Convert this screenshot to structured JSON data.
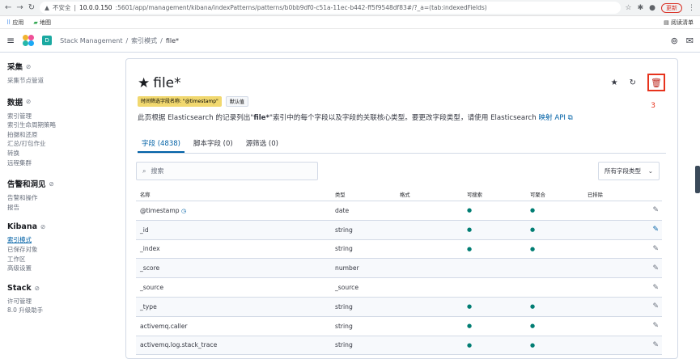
{
  "browser": {
    "security": "不安全",
    "url_host": "10.0.0.150",
    "url_rest": ":5601/app/management/kibana/indexPatterns/patterns/b0bb9df0-c51a-11ec-b442-ff5f9548df83#/?_a=(tab:indexedFields)",
    "update_label": "更新",
    "bookmarks": [
      "应用",
      "地图"
    ],
    "reading_list": "阅读清单"
  },
  "header": {
    "space_letter": "D",
    "breadcrumb": [
      "Stack Management",
      "索引模式",
      "file*"
    ]
  },
  "sidebar": {
    "sections": [
      {
        "title": "采集",
        "items": [
          "采集节点管道"
        ]
      },
      {
        "title": "数据",
        "items": [
          "索引管理",
          "索引生命周期策略",
          "拍摄和还原",
          "汇总/打包作业",
          "转换",
          "远程集群"
        ]
      },
      {
        "title": "告警和洞见",
        "items": [
          "告警和操作",
          "报告"
        ]
      },
      {
        "title": "Kibana",
        "items": [
          "索引模式",
          "已保存对象",
          "工作区",
          "高级设置"
        ]
      },
      {
        "title": "Stack",
        "items": [
          "许可管理",
          "8.0 升级助手"
        ]
      }
    ],
    "active_item": "索引模式"
  },
  "panel": {
    "title": "file*",
    "badge_time": "时间筛选字段名称: \"@timestamp\"",
    "badge_default": "默认值",
    "annotation": "3",
    "desc_pre": "此页根据 Elasticsearch 的记录列出\"",
    "desc_bold": "file*",
    "desc_mid": "\"索引中的每个字段以及字段的关联核心类型。要更改字段类型，请使用 Elasticsearch ",
    "desc_link": "映射 API",
    "tabs": [
      "字段 (4838)",
      "脚本字段 (0)",
      "源筛选 (0)"
    ],
    "search_placeholder": "搜索",
    "filter_label": "所有字段类型",
    "columns": {
      "name": "名称",
      "type": "类型",
      "format": "格式",
      "searchable": "可搜索",
      "aggregatable": "可聚合",
      "excluded": "已排除"
    },
    "rows": [
      {
        "name": "@timestamp",
        "type": "date",
        "searchable": true,
        "aggregatable": true,
        "clock": true
      },
      {
        "name": "_id",
        "type": "string",
        "searchable": true,
        "aggregatable": true,
        "blue_edit": true
      },
      {
        "name": "_index",
        "type": "string",
        "searchable": true,
        "aggregatable": true
      },
      {
        "name": "_score",
        "type": "number",
        "searchable": false,
        "aggregatable": false
      },
      {
        "name": "_source",
        "type": "_source",
        "searchable": false,
        "aggregatable": false
      },
      {
        "name": "_type",
        "type": "string",
        "searchable": true,
        "aggregatable": true
      },
      {
        "name": "activemq.caller",
        "type": "string",
        "searchable": true,
        "aggregatable": true
      },
      {
        "name": "activemq.log.stack_trace",
        "type": "string",
        "searchable": true,
        "aggregatable": true
      }
    ]
  },
  "icons": {
    "back": "back-arrow-icon",
    "forward": "forward-arrow-icon",
    "reload": "reload-icon",
    "delete": "trash-icon",
    "star": "star-icon",
    "refresh": "refresh-icon",
    "edit": "pencil-icon",
    "search": "search-icon",
    "clock": "clock-icon"
  },
  "colors": {
    "accent": "#0061a6",
    "danger": "#e7331d",
    "badge_time": "#f1d86f",
    "space": "#1ba9a1"
  }
}
